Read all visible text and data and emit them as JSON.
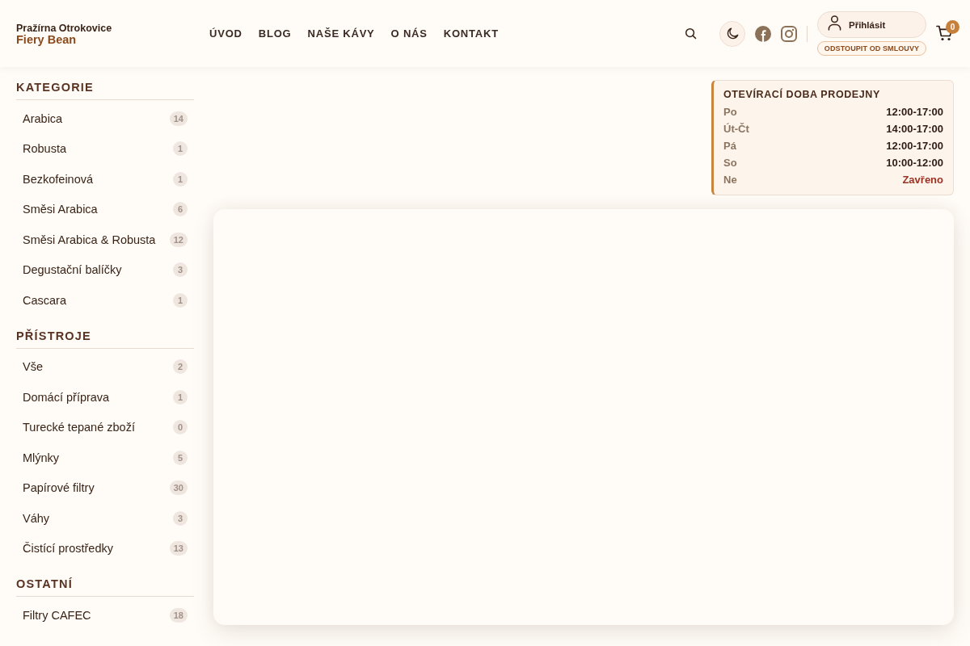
{
  "header": {
    "brand": {
      "subtitle": "Pražírna Otrokovice",
      "name": "Fiery Bean"
    },
    "nav": [
      {
        "label": "ÚVOD"
      },
      {
        "label": "BLOG"
      },
      {
        "label": "NAŠE KÁVY"
      },
      {
        "label": "O NÁS"
      },
      {
        "label": "KONTAKT"
      }
    ],
    "login": {
      "label": "Přihlásit"
    },
    "withdraw_button": {
      "label": "ODSTOUPIT OD SMLOUVY"
    },
    "cart": {
      "count": "0"
    }
  },
  "sidebar": {
    "sections": [
      {
        "title": "KATEGORIE",
        "items": [
          {
            "label": "Arabica",
            "count": "14"
          },
          {
            "label": "Robusta",
            "count": "1"
          },
          {
            "label": "Bezkofeinová",
            "count": "1"
          },
          {
            "label": "Směsi Arabica",
            "count": "6"
          },
          {
            "label": "Směsi Arabica & Robusta",
            "count": "12"
          },
          {
            "label": "Degustační balíčky",
            "count": "3"
          },
          {
            "label": "Cascara",
            "count": "1"
          }
        ]
      },
      {
        "title": "PŘÍSTROJE",
        "items": [
          {
            "label": "Vše",
            "count": "2"
          },
          {
            "label": "Domácí příprava",
            "count": "1"
          },
          {
            "label": "Turecké tepané zboží",
            "count": "0"
          },
          {
            "label": "Mlýnky",
            "count": "5"
          },
          {
            "label": "Papírové filtry",
            "count": "30"
          },
          {
            "label": "Váhy",
            "count": "3"
          },
          {
            "label": "Čistící prostředky",
            "count": "13"
          }
        ]
      },
      {
        "title": "OSTATNÍ",
        "items": [
          {
            "label": "Filtry CAFEC",
            "count": "18"
          }
        ]
      }
    ]
  },
  "opening_hours": {
    "title": "OTEVÍRACÍ DOBA PRODEJNY",
    "rows": [
      {
        "day": "Po",
        "hours": "12:00-17:00",
        "closed": false
      },
      {
        "day": "Út-Čt",
        "hours": "14:00-17:00",
        "closed": false
      },
      {
        "day": "Pá",
        "hours": "12:00-17:00",
        "closed": false
      },
      {
        "day": "So",
        "hours": "10:00-12:00",
        "closed": false
      },
      {
        "day": "Ne",
        "hours": "Zavřeno",
        "closed": true
      }
    ]
  }
}
